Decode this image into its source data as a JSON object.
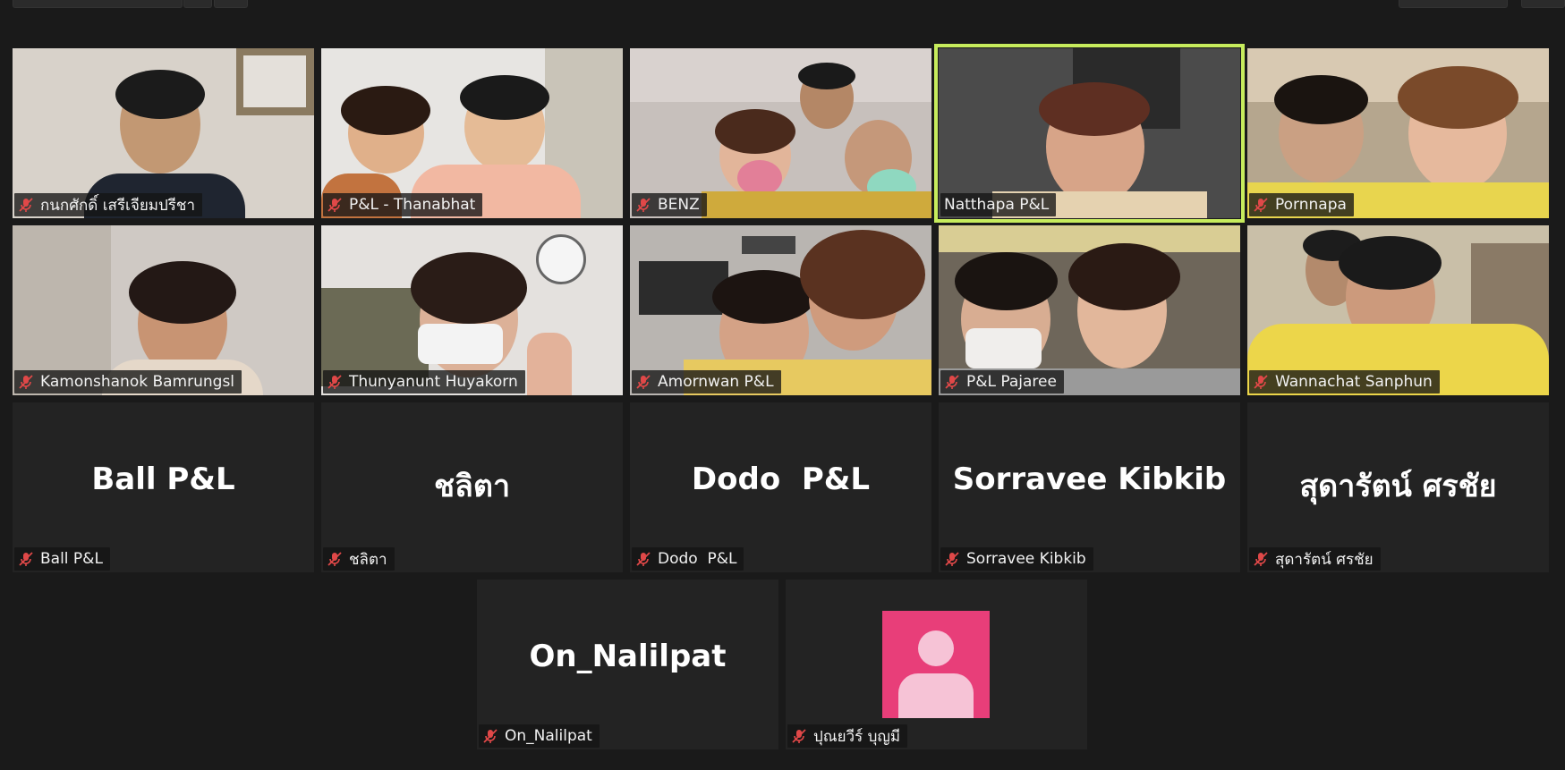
{
  "participants": [
    {
      "name": "กนกศักดิ์ เสรีเจียมปรีชา",
      "muted": true,
      "video": true
    },
    {
      "name": "P&L - Thanabhat",
      "muted": true,
      "video": true
    },
    {
      "name": "BENZ",
      "muted": true,
      "video": true
    },
    {
      "name": "Natthapa P&L",
      "muted": false,
      "video": true,
      "speaking": true
    },
    {
      "name": "Pornnapa",
      "muted": true,
      "video": true
    },
    {
      "name": "Kamonshanok Bamrungsl",
      "muted": true,
      "video": true
    },
    {
      "name": "Thunyanunt Huyakorn",
      "muted": true,
      "video": true
    },
    {
      "name": "Amornwan P&L",
      "muted": true,
      "video": true
    },
    {
      "name": "P&L Pajaree",
      "muted": true,
      "video": true
    },
    {
      "name": "Wannachat Sanphun",
      "muted": true,
      "video": true
    },
    {
      "name": "Ball P&L",
      "muted": true,
      "video": false
    },
    {
      "name": "ชลิตา",
      "muted": true,
      "video": false
    },
    {
      "name": "Dodo  P&L",
      "muted": true,
      "video": false
    },
    {
      "name": "Sorravee Kibkib",
      "muted": true,
      "video": false
    },
    {
      "name": "สุดารัตน์ ศรชัย",
      "muted": true,
      "video": false
    },
    {
      "name": "On_Nalilpat",
      "muted": true,
      "video": false
    },
    {
      "name": "ปุณยวีร์ บุญมี",
      "muted": true,
      "video": false,
      "avatar": true
    }
  ],
  "icons": {
    "muted_mic": "mic-off-icon",
    "avatar": "person-avatar-icon"
  },
  "colors": {
    "background": "#1a1a1a",
    "tile": "#232323",
    "speaking_border": "#c7ec5d",
    "mute_red": "#e04848",
    "avatar_bg": "#e83e79",
    "avatar_fg": "#f6c3d6"
  }
}
